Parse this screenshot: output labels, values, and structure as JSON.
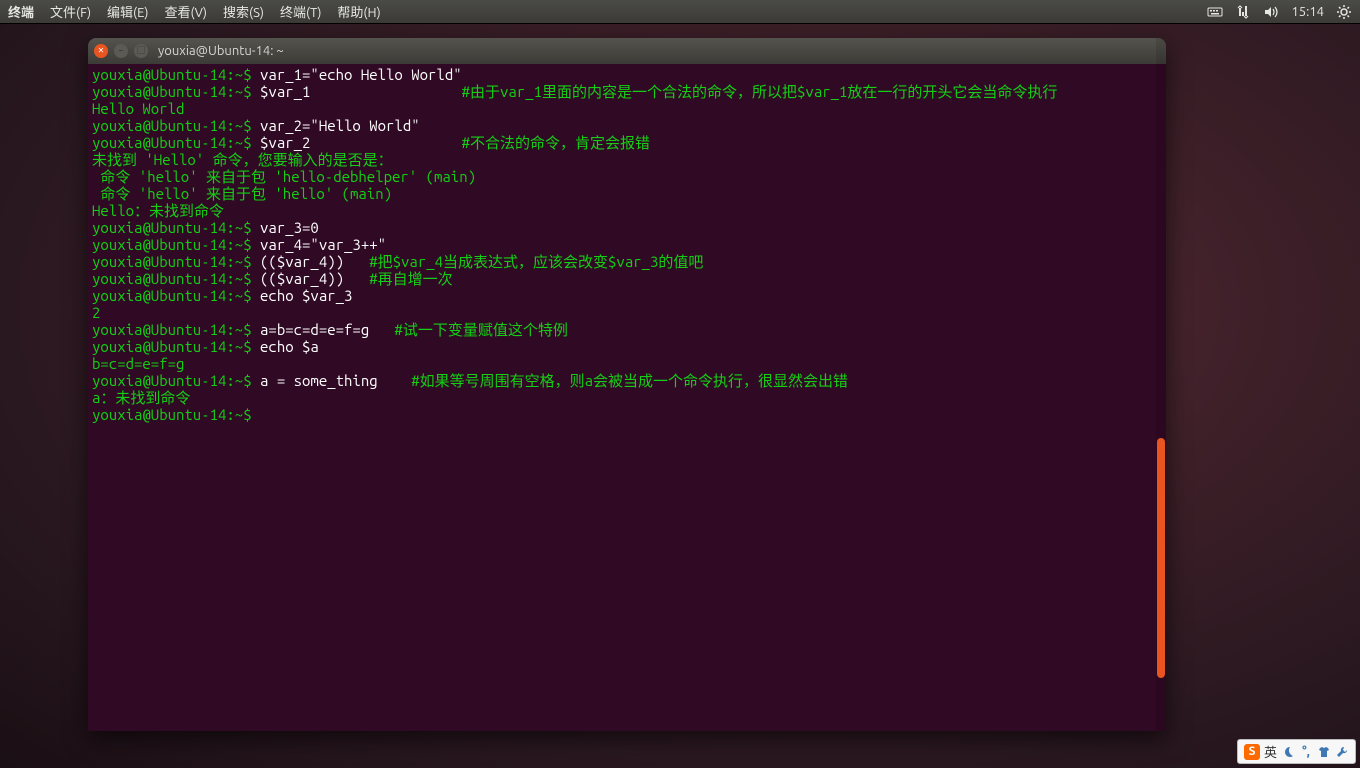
{
  "topbar": {
    "app": "终端",
    "menus": [
      "文件(F)",
      "编辑(E)",
      "查看(V)",
      "搜索(S)",
      "终端(T)",
      "帮助(H)"
    ],
    "clock": "15:14"
  },
  "window": {
    "title": "youxia@Ubuntu-14: ~"
  },
  "terminal": {
    "prompt": "youxia@Ubuntu-14:~$ ",
    "lines": [
      {
        "t": "cmd",
        "text": "var_1=\"echo Hello World\""
      },
      {
        "t": "cmd",
        "text": "$var_1",
        "pad": 24,
        "comment": "#由于var_1里面的内容是一个合法的命令，所以把$var_1放在一行的开头它会当命令执行"
      },
      {
        "t": "outg",
        "text": "Hello World"
      },
      {
        "t": "cmd",
        "text": "var_2=\"Hello World\""
      },
      {
        "t": "cmd",
        "text": "$var_2",
        "pad": 24,
        "comment": "#不合法的命令，肯定会报错"
      },
      {
        "t": "outg",
        "text": "未找到 'Hello' 命令，您要输入的是否是："
      },
      {
        "t": "outg",
        "text": " 命令 'hello' 来自于包 'hello-debhelper' (main)"
      },
      {
        "t": "outg",
        "text": " 命令 'hello' 来自于包 'hello' (main)"
      },
      {
        "t": "outg",
        "text": "Hello：未找到命令"
      },
      {
        "t": "cmd",
        "text": "var_3=0"
      },
      {
        "t": "cmd",
        "text": "var_4=\"var_3++\""
      },
      {
        "t": "cmd",
        "text": "(($var_4))",
        "pad": 13,
        "comment": "#把$var_4当成表达式，应该会改变$var_3的值吧"
      },
      {
        "t": "cmd",
        "text": "(($var_4))",
        "pad": 13,
        "comment": "#再自增一次"
      },
      {
        "t": "cmd",
        "text": "echo $var_3"
      },
      {
        "t": "outg",
        "text": "2"
      },
      {
        "t": "cmd",
        "text": "a=b=c=d=e=f=g",
        "pad": 16,
        "comment": "#试一下变量赋值这个特例"
      },
      {
        "t": "cmd",
        "text": "echo $a"
      },
      {
        "t": "outg",
        "text": "b=c=d=e=f=g"
      },
      {
        "t": "cmd",
        "text": "a = some_thing",
        "pad": 18,
        "comment": "#如果等号周围有空格，则a会被当成一个命令执行，很显然会出错"
      },
      {
        "t": "outg",
        "text": "a：未找到命令"
      },
      {
        "t": "cmd",
        "text": ""
      }
    ]
  },
  "ime": {
    "label": "英"
  }
}
